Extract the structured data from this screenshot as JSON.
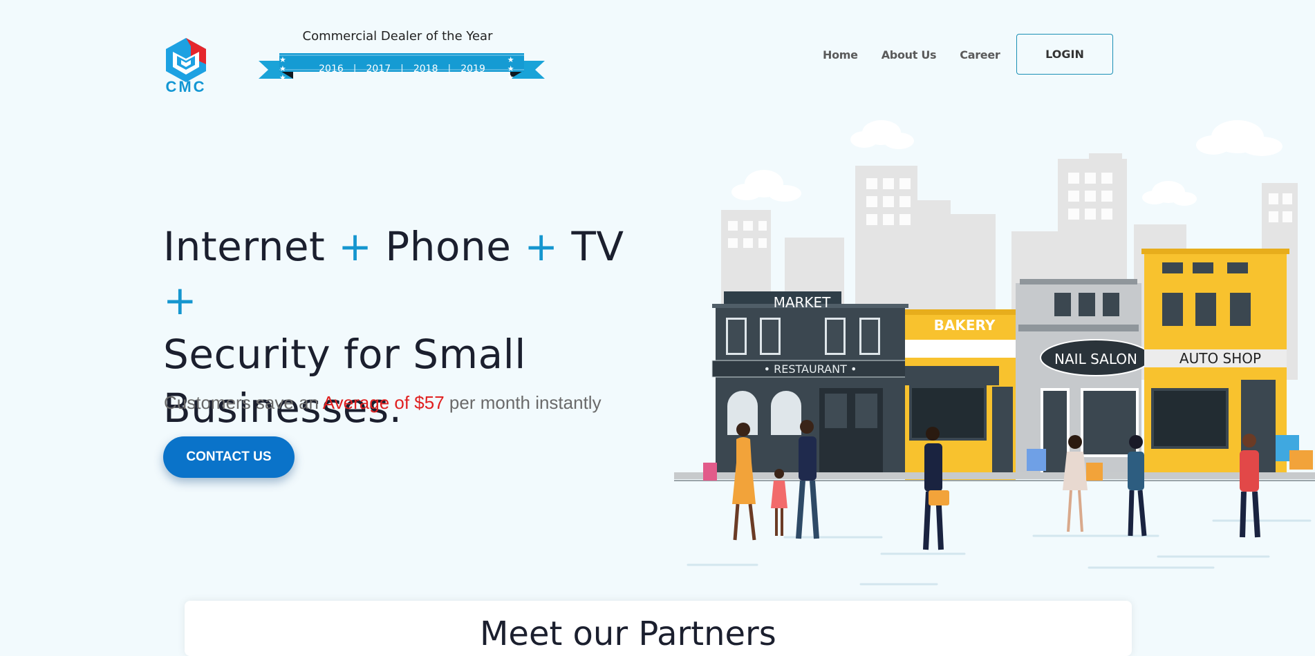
{
  "header": {
    "logo_text": "CMC",
    "award": {
      "title": "Commercial Dealer of the Year",
      "stars": "★ ★ ★",
      "years": [
        "2016",
        "2017",
        "2018",
        "2019"
      ]
    },
    "nav": [
      "Home",
      "About Us",
      "Career"
    ],
    "login_label": "LOGIN"
  },
  "hero": {
    "headline": {
      "w1": "Internet",
      "w2": "Phone",
      "w3": "TV",
      "w4": "Security for Small",
      "w5": "Businesses.",
      "plus": "+"
    },
    "subline": {
      "prefix": "Customers save an",
      "accent": "Average of $57",
      "suffix": "per month instantly"
    },
    "contact_label": "CONTACT US"
  },
  "illustration": {
    "signs": {
      "market": "MARKET",
      "restaurant": "• RESTAURANT •",
      "bakery": "BAKERY",
      "nail_salon": "NAIL SALON",
      "auto_shop": "AUTO SHOP"
    }
  },
  "bottom_card": {
    "heading_partial": "Meet our Partners"
  },
  "colors": {
    "accent": "#1596cf",
    "primary_button": "#0a73c9",
    "highlight": "#e02020",
    "background": "#f2fafd"
  }
}
